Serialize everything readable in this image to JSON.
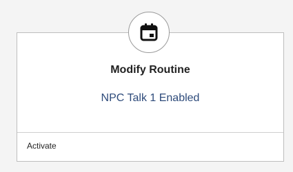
{
  "node": {
    "icon": "calendar-icon",
    "title": "Modify Routine",
    "subtitle": "NPC Talk 1 Enabled",
    "ports": [
      {
        "label": "Activate"
      }
    ]
  },
  "colors": {
    "background": "#f4f4f4",
    "card": "#ffffff",
    "border": "#bdbdbd",
    "subtitle": "#2d4a7a"
  }
}
